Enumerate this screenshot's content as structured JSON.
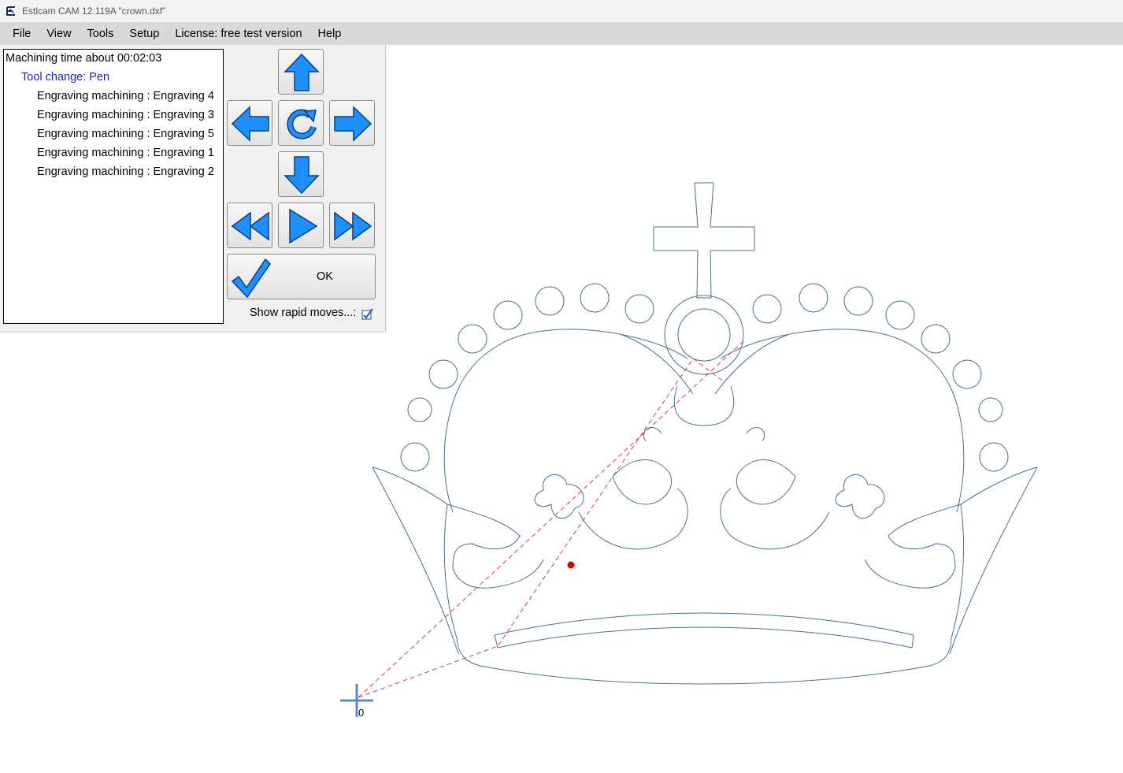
{
  "window": {
    "title": "Estlcam CAM 12.119A \"crown.dxf\""
  },
  "menu": {
    "items": [
      "File",
      "View",
      "Tools",
      "Setup",
      "License: free test version",
      "Help"
    ]
  },
  "operations": {
    "summary": "Machining time about 00:02:03",
    "tool_change": "Tool change: Pen",
    "items": [
      "Engraving machining : Engraving 4",
      "Engraving machining : Engraving 3",
      "Engraving machining : Engraving 5",
      "Engraving machining : Engraving 1",
      "Engraving machining : Engraving 2"
    ]
  },
  "controls": {
    "ok_label": "OK",
    "show_rapid_moves_label": "Show rapid moves...:",
    "show_rapid_moves_checked": true,
    "icons": [
      "arrow-up-icon",
      "arrow-left-icon",
      "rotate-icon",
      "arrow-right-icon",
      "arrow-down-icon",
      "rewind-icon",
      "play-icon",
      "fast-forward-icon",
      "checkmark-icon"
    ]
  },
  "canvas": {
    "origin_label": "0"
  },
  "colors": {
    "accent": "#1e90ff",
    "path": "#4a6f8f",
    "rapid": "#d04050",
    "tool_dot": "#e00000",
    "tool_change_text": "#1f1fcf"
  }
}
